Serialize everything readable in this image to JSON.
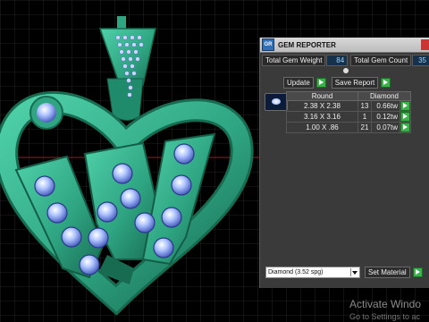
{
  "panel": {
    "title": "GEM REPORTER",
    "icon": "gem-reporter-icon",
    "total_weight_label": "Total Gem Weight",
    "total_weight_value": "84",
    "total_count_label": "Total Gem Count",
    "total_count_value": "35",
    "update_label": "Update",
    "save_report_label": "Save Report",
    "table": {
      "headers": [
        "Round",
        "Diamond"
      ],
      "rows": [
        {
          "size": "2.38 X 2.38",
          "count": "13",
          "carat": "0.66tw"
        },
        {
          "size": "3.16 X 3.16",
          "count": "1",
          "carat": "0.12tw"
        },
        {
          "size": "1.00 X .86",
          "count": "21",
          "carat": "0.07tw"
        }
      ]
    },
    "material_value": "Diamond    (3.52 spg)",
    "set_material_label": "Set Material"
  },
  "watermark": {
    "title": "Activate Windo",
    "subtitle": "Go to Settings to ac"
  },
  "colors": {
    "metal": "#2fa582",
    "metal_dark": "#176b50",
    "gem": "#8fb0ff",
    "grid": "#3d3d3d",
    "axis": "#c02020",
    "accent_green": "#3bb14a"
  }
}
